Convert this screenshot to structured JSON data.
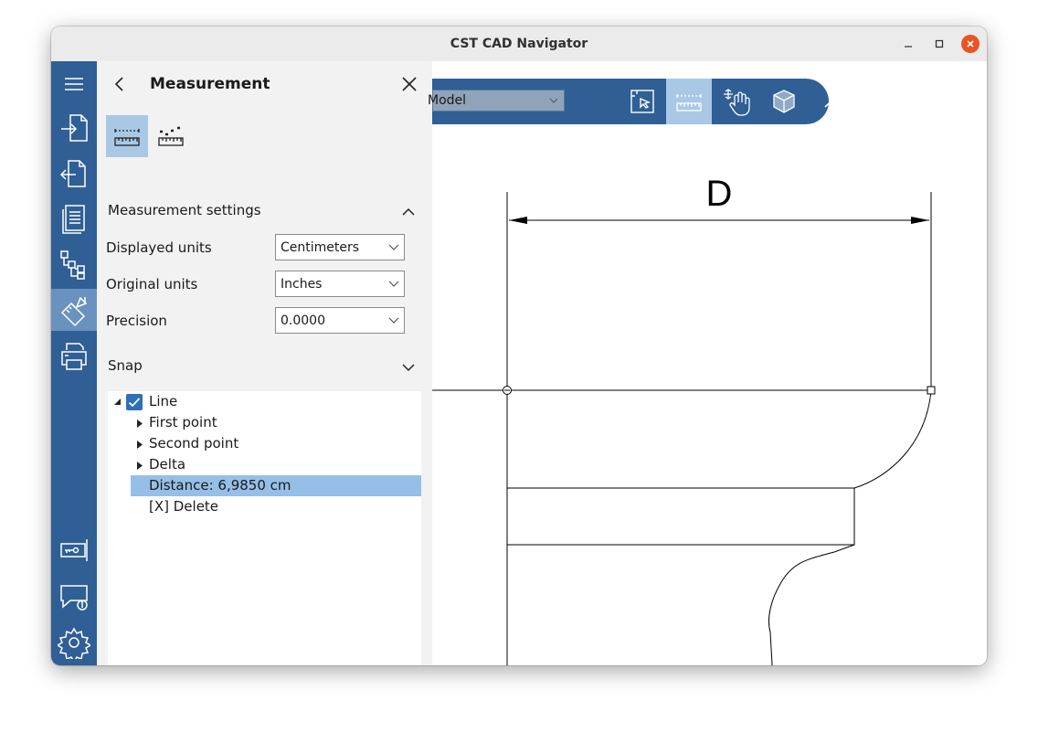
{
  "window": {
    "title": "CST CAD Navigator"
  },
  "sidebar": {
    "items": [
      {
        "icon": "menu-icon"
      },
      {
        "icon": "import-icon"
      },
      {
        "icon": "export-icon"
      },
      {
        "icon": "document-icon"
      },
      {
        "icon": "structure-tree-icon"
      },
      {
        "icon": "measure-tools-icon",
        "active": true
      },
      {
        "icon": "print-icon"
      },
      {
        "icon": "license-key-icon"
      },
      {
        "icon": "feedback-info-icon"
      },
      {
        "icon": "settings-gear-icon"
      }
    ]
  },
  "panel": {
    "title": "Measurement",
    "settings_section": "Measurement settings",
    "rows": [
      {
        "label": "Displayed units",
        "value": "Centimeters"
      },
      {
        "label": "Original units",
        "value": "Inches"
      },
      {
        "label": "Precision",
        "value": "0.0000"
      }
    ],
    "snap_section": "Snap",
    "tree": {
      "root": "Line",
      "children": [
        "First point",
        "Second point",
        "Delta"
      ],
      "distance": "Distance: 6,9850 cm",
      "delete": "[X] Delete"
    }
  },
  "toolbar": {
    "model_value": "Model"
  },
  "drawing": {
    "dimension_label": "D"
  },
  "colors": {
    "sidebar_bg": "#2f5f95",
    "active_bg": "#a9c8e5",
    "selection": "#95bfe6",
    "close_button": "#e95420"
  }
}
